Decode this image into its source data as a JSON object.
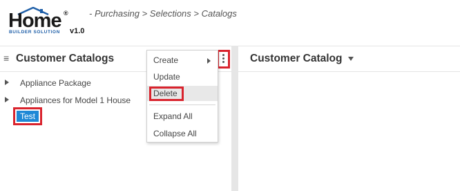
{
  "logo": {
    "name": "Home",
    "registered": "®",
    "subtitle": "BUILDER SOLUTION",
    "version": "v1.0"
  },
  "breadcrumb": "- Purchasing > Selections > Catalogs",
  "left_panel": {
    "title": "Customer Catalogs",
    "menu_icon": "hamburger-icon",
    "options_icon": "kebab-vertical-icon",
    "tree": [
      {
        "label": "Appliance Package",
        "expandable": true
      },
      {
        "label": "Appliances for Model 1 House",
        "expandable": true
      },
      {
        "label": "Test",
        "expandable": false,
        "selected": true
      }
    ]
  },
  "context_menu": {
    "items": [
      {
        "label": "Create",
        "has_submenu": true
      },
      {
        "label": "Update"
      },
      {
        "label": "Delete",
        "highlighted": true
      },
      {
        "label": "Expand All"
      },
      {
        "label": "Collapse All"
      }
    ]
  },
  "right_panel": {
    "title": "Customer Catalog",
    "dropdown_icon": "caret-down-icon"
  },
  "colors": {
    "highlight_border": "#d9232d",
    "selected_node": "#1e88d6",
    "logo_blue": "#1f5fa8",
    "splitter": "#e6e6e6"
  }
}
